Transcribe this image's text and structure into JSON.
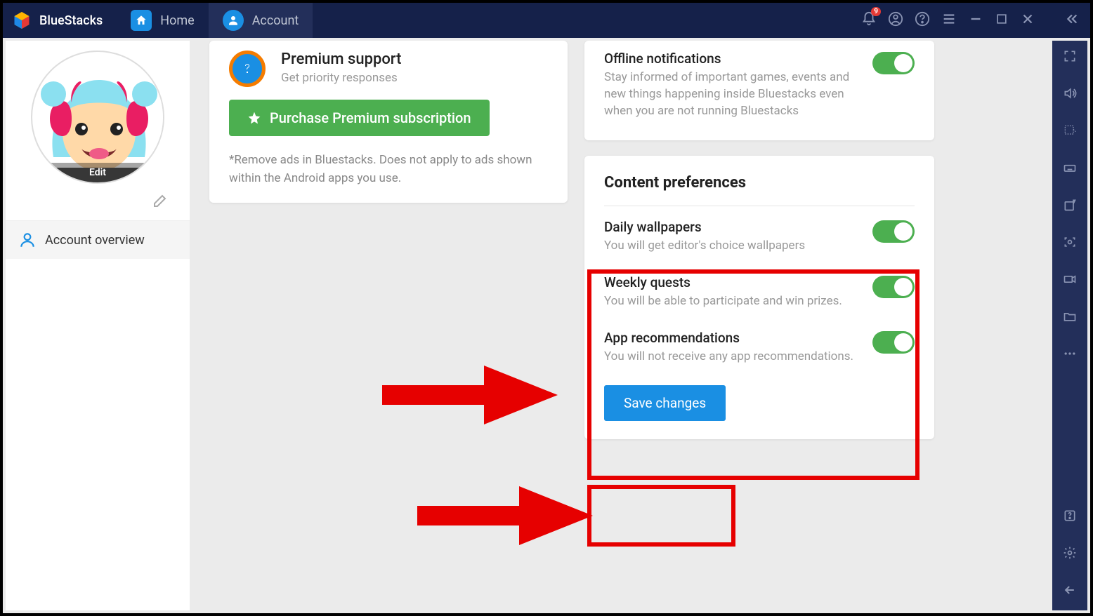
{
  "title": "BlueStacks",
  "tabs": {
    "home": "Home",
    "account": "Account"
  },
  "notifications": {
    "count": "9"
  },
  "sidebar": {
    "avatar_edit": "Edit",
    "nav_account_overview": "Account overview"
  },
  "premium": {
    "feature_title": "Premium support",
    "feature_sub": "Get priority responses",
    "purchase_button": "Purchase Premium subscription",
    "footnote": "*Remove ads in Bluestacks. Does not apply to ads shown within the Android apps you use."
  },
  "offline": {
    "title": "Offline notifications",
    "sub": "Stay informed of important games, events and new things happening inside Bluestacks even when you are not running Bluestacks"
  },
  "content_prefs": {
    "title": "Content preferences",
    "items": [
      {
        "title": "Daily wallpapers",
        "sub": "You will get editor's choice wallpapers"
      },
      {
        "title": "Weekly quests",
        "sub": "You will be able to participate and win prizes."
      },
      {
        "title": "App recommendations",
        "sub": "You will not receive any app recommendations."
      }
    ],
    "save": "Save changes"
  }
}
